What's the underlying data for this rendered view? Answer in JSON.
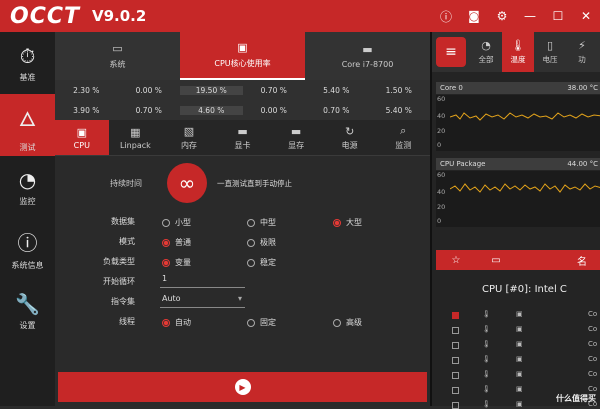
{
  "app": {
    "logo": "OCCT",
    "version": "V9.0.2"
  },
  "sidebar": {
    "items": [
      {
        "label": "基准"
      },
      {
        "label": "测试"
      },
      {
        "label": "监控"
      },
      {
        "label": "系统信息"
      },
      {
        "label": "设置"
      }
    ]
  },
  "cpu_tabs": [
    {
      "label": "系统"
    },
    {
      "label": "CPU核心使用率"
    },
    {
      "label": "Core i7-8700"
    }
  ],
  "usage_rows": [
    [
      "2.30 %",
      "0.00 %",
      "19.50 %",
      "0.70 %",
      "5.40 %",
      "1.50 %"
    ],
    [
      "3.90 %",
      "0.70 %",
      "4.60 %",
      "0.00 %",
      "0.70 %",
      "5.40 %"
    ]
  ],
  "sub_tabs": [
    {
      "label": "CPU"
    },
    {
      "label": "Linpack"
    },
    {
      "label": "内存"
    },
    {
      "label": "显卡"
    },
    {
      "label": "显存"
    },
    {
      "label": "电源"
    },
    {
      "label": "监测"
    }
  ],
  "form": {
    "duration_label": "持续时间",
    "duration_text": "一直测试直到手动停止",
    "dataset_label": "数据集",
    "dataset_options": [
      "小型",
      "中型",
      "大型"
    ],
    "mode_label": "模式",
    "mode_options": [
      "普通",
      "极限"
    ],
    "load_label": "负载类型",
    "load_options": [
      "变量",
      "稳定"
    ],
    "cycle_label": "开始循环",
    "cycle_value": "1",
    "instr_label": "指令集",
    "instr_value": "Auto",
    "thread_label": "线程",
    "thread_options": [
      "自动",
      "固定",
      "高级"
    ]
  },
  "right": {
    "tabs": [
      {
        "label": "全部"
      },
      {
        "label": "温度"
      },
      {
        "label": "电压"
      },
      {
        "label": "功"
      }
    ],
    "graphs": [
      {
        "name": "Core 0",
        "value": "38.00 °C",
        "ticks": [
          "60",
          "40",
          "20",
          "0"
        ]
      },
      {
        "name": "CPU Package",
        "value": "44.00 °C",
        "ticks": [
          "60",
          "40",
          "20",
          "0"
        ]
      }
    ],
    "filters": [
      "☆",
      "▭",
      "名"
    ],
    "cpu_title": "CPU [#0]: Intel C",
    "row_label": "Co"
  },
  "watermark": "什么值得买"
}
